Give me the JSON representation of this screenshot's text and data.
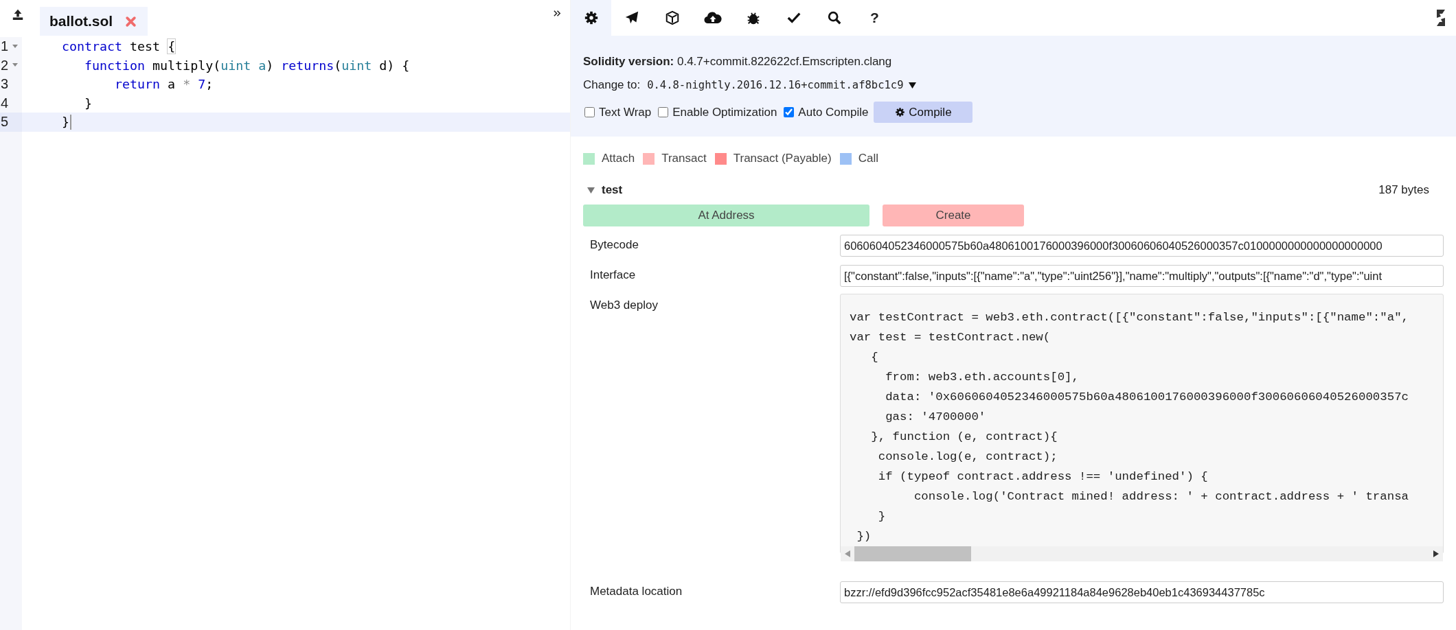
{
  "editor": {
    "tabs": [
      {
        "label": "ballot.sol",
        "selected": true
      }
    ],
    "lines": [
      {
        "number": "1",
        "foldable": true,
        "active": false,
        "tokens": [
          {
            "kind": "keyword",
            "text": "    contract"
          },
          {
            "kind": "plain",
            "text": " test "
          },
          {
            "kind": "bracket",
            "text": "{"
          }
        ]
      },
      {
        "number": "2",
        "foldable": true,
        "active": false,
        "tokens": [
          {
            "kind": "keyword",
            "text": "       function"
          },
          {
            "kind": "plain",
            "text": " multiply("
          },
          {
            "kind": "type",
            "text": "uint a"
          },
          {
            "kind": "plain",
            "text": ") "
          },
          {
            "kind": "keyword",
            "text": "returns"
          },
          {
            "kind": "plain",
            "text": "("
          },
          {
            "kind": "type",
            "text": "uint"
          },
          {
            "kind": "plain",
            "text": " d) {"
          }
        ]
      },
      {
        "number": "3",
        "foldable": false,
        "active": false,
        "tokens": [
          {
            "kind": "keyword",
            "text": "           return"
          },
          {
            "kind": "plain",
            "text": " a "
          },
          {
            "kind": "operator",
            "text": "*"
          },
          {
            "kind": "number",
            "text": " 7"
          },
          {
            "kind": "plain",
            "text": ";"
          }
        ]
      },
      {
        "number": "4",
        "foldable": false,
        "active": false,
        "tokens": [
          {
            "kind": "plain",
            "text": "       }"
          }
        ]
      },
      {
        "number": "5",
        "foldable": false,
        "active": true,
        "tokens": [
          {
            "kind": "plain",
            "text": "    }"
          }
        ]
      }
    ]
  },
  "toolbar": [
    {
      "selected": true
    },
    {
      "selected": false
    },
    {
      "selected": false
    },
    {
      "selected": false
    },
    {
      "selected": false
    },
    {
      "selected": false
    },
    {
      "selected": false
    },
    {
      "selected": false,
      "label": "?"
    }
  ],
  "settings": {
    "version_label": "Solidity version:",
    "version": "0.4.7+commit.822622cf.Emscripten.clang",
    "change_label": "Change to:",
    "change_value": "0.4.8-nightly.2016.12.16+commit.af8bc1c9",
    "options": [
      {
        "label": "Text Wrap",
        "checked": false
      },
      {
        "label": "Enable Optimization",
        "checked": false
      },
      {
        "label": "Auto Compile",
        "checked": true
      }
    ],
    "compile_button": "Compile"
  },
  "legend": [
    {
      "label": "Attach",
      "color": "#b3ebc9"
    },
    {
      "label": "Transact",
      "color": "#ffb6b6"
    },
    {
      "label": "Transact (Payable)",
      "color": "#ff8a8a"
    },
    {
      "label": "Call",
      "color": "#9dc1f5"
    }
  ],
  "contract": {
    "name": "test",
    "expanded": true,
    "size": "187 bytes",
    "buttons": [
      {
        "label": "At Address",
        "kind": "attach"
      },
      {
        "label": "Create",
        "kind": "transact"
      }
    ],
    "details": [
      {
        "kind": "field",
        "label": "Bytecode",
        "value": "6060604052346000575b60a4806100176000396000f30060606040526000357c0100000000000000000000"
      },
      {
        "kind": "field",
        "label": "Interface",
        "value": "[{\"constant\":false,\"inputs\":[{\"name\":\"a\",\"type\":\"uint256\"}],\"name\":\"multiply\",\"outputs\":[{\"name\":\"d\",\"type\":\"uint"
      },
      {
        "kind": "code",
        "label": "Web3 deploy",
        "lines": [
          "var testContract = web3.eth.contract([{\"constant\":false,\"inputs\":[{\"name\":\"a\",",
          "var test = testContract.new(",
          "   {",
          "     from: web3.eth.accounts[0],",
          "     data: '0x6060604052346000575b60a4806100176000396000f30060606040526000357c",
          "     gas: '4700000'",
          "   }, function (e, contract){",
          "    console.log(e, contract);",
          "    if (typeof contract.address !== 'undefined') {",
          "         console.log('Contract mined! address: ' + contract.address + ' transa",
          "    }",
          " })"
        ]
      },
      {
        "kind": "field",
        "label": "Metadata location",
        "value": "bzzr://efd9d396fcc952acf35481e8e6a49921184a84e9628eb40eb1c436934437785c"
      }
    ]
  }
}
